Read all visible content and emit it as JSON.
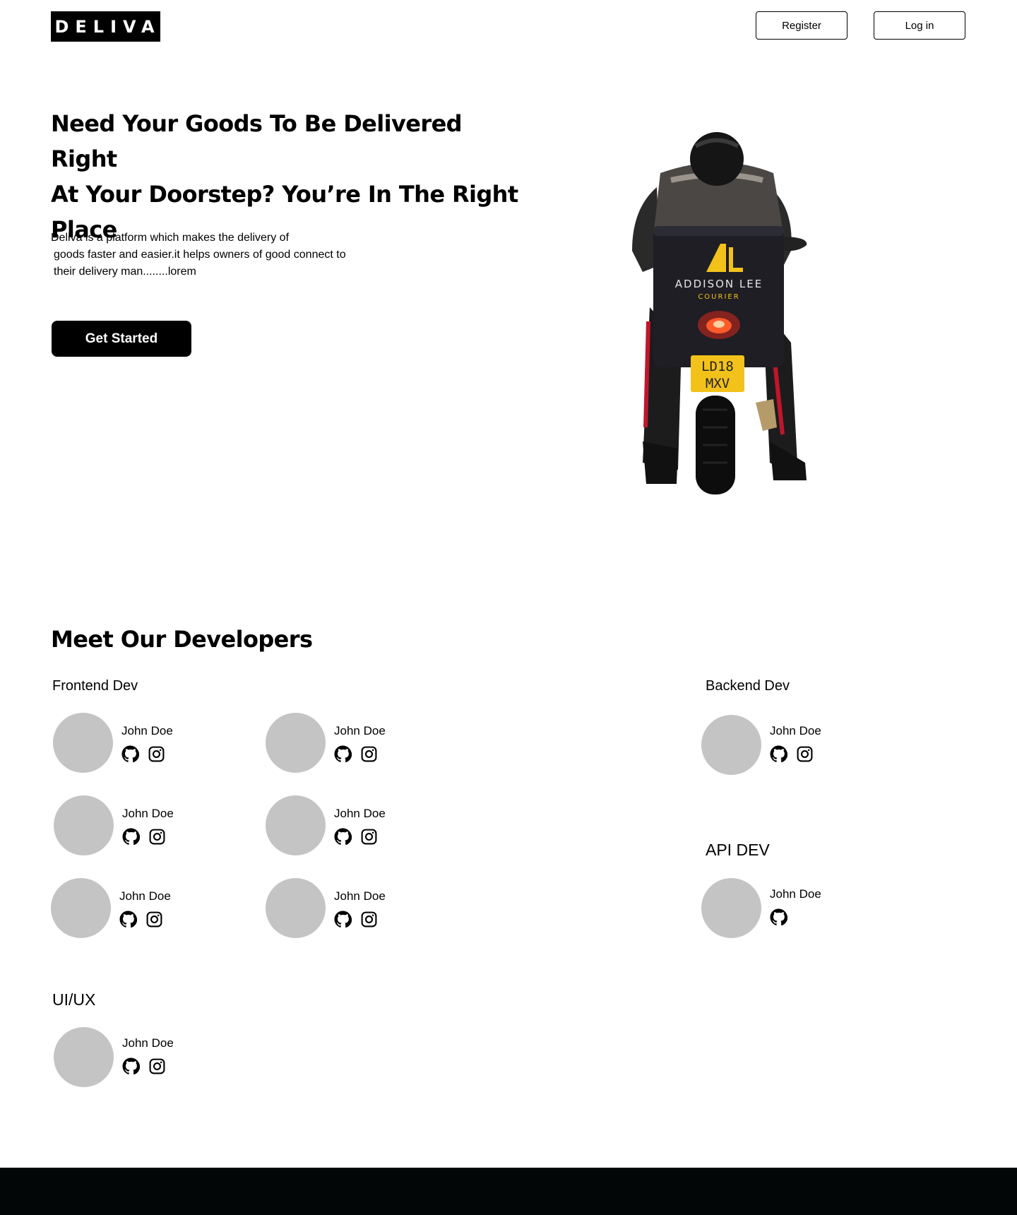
{
  "header": {
    "logo_text": "DELIVA",
    "register_label": "Register",
    "login_label": "Log in"
  },
  "hero": {
    "title_lines": [
      "Need Your Goods To Be Delivered Right",
      "At Your Doorstep? You’re In The Right",
      "Place"
    ],
    "description_lines": [
      "Deliva is a platform which makes the delivery of",
      "goods faster and easier.it helps owners of good connect to",
      "their delivery man........lorem"
    ],
    "cta_label": "Get Started",
    "image": {
      "box_logo": "AL",
      "box_brand": "ADDISON LEE",
      "box_sub": "COURIER",
      "plate_line1": "LD18",
      "plate_line2": "MXV"
    }
  },
  "developers": {
    "title": "Meet Our Developers",
    "groups": {
      "frontend": {
        "label": "Frontend Dev",
        "members": [
          {
            "name": "John Doe",
            "icons": [
              "github-icon",
              "instagram-icon"
            ]
          },
          {
            "name": "John Doe",
            "icons": [
              "github-icon",
              "instagram-icon"
            ]
          },
          {
            "name": "John Doe",
            "icons": [
              "github-icon",
              "instagram-icon"
            ]
          },
          {
            "name": "John Doe",
            "icons": [
              "github-icon",
              "instagram-icon"
            ]
          },
          {
            "name": "John Doe",
            "icons": [
              "github-icon",
              "instagram-icon"
            ]
          },
          {
            "name": "John Doe",
            "icons": [
              "github-icon",
              "instagram-icon"
            ]
          }
        ]
      },
      "backend": {
        "label": "Backend Dev",
        "members": [
          {
            "name": "John Doe",
            "icons": [
              "github-icon",
              "instagram-icon"
            ]
          }
        ]
      },
      "api": {
        "label": "API DEV",
        "members": [
          {
            "name": "John Doe",
            "icons": [
              "github-icon"
            ]
          }
        ]
      },
      "uiux": {
        "label": "UI/UX",
        "members": [
          {
            "name": "John Doe",
            "icons": [
              "github-icon",
              "instagram-icon"
            ]
          }
        ]
      }
    }
  },
  "colors": {
    "brand_black": "#000000",
    "avatar_gray": "#c4c4c4",
    "footer_bg": "#030606",
    "courier_yellow": "#f2c21a"
  }
}
